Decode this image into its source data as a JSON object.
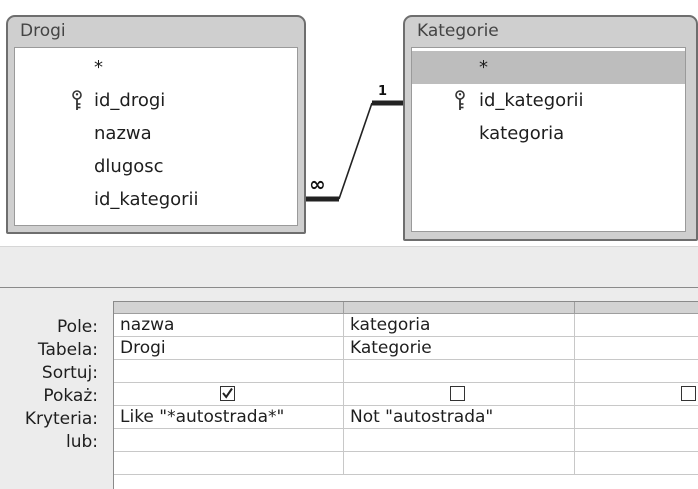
{
  "diagram": {
    "tables": [
      {
        "title": "Drogi",
        "fields": [
          {
            "name": "*",
            "is_key": false
          },
          {
            "name": "id_drogi",
            "is_key": true
          },
          {
            "name": "nazwa",
            "is_key": false
          },
          {
            "name": "dlugosc",
            "is_key": false
          },
          {
            "name": "id_kategorii",
            "is_key": false
          }
        ]
      },
      {
        "title": "Kategorie",
        "fields": [
          {
            "name": "*",
            "is_key": false,
            "selected": true
          },
          {
            "name": "id_kategorii",
            "is_key": true
          },
          {
            "name": "kategoria",
            "is_key": false
          }
        ]
      }
    ],
    "relationship": {
      "one_label": "1",
      "many_label": "∞"
    }
  },
  "grid": {
    "row_labels": {
      "pole": "Pole:",
      "tabela": "Tabela:",
      "sortuj": "Sortuj:",
      "pokaz": "Pokaż:",
      "kryteria": "Kryteria:",
      "lub": "lub:"
    },
    "columns": [
      {
        "pole": "nazwa",
        "tabela": "Drogi",
        "sortuj": "",
        "pokaz": true,
        "kryteria": "Like \"*autostrada*\"",
        "lub": ""
      },
      {
        "pole": "kategoria",
        "tabela": "Kategorie",
        "sortuj": "",
        "pokaz": false,
        "kryteria": "Not \"autostrada\"",
        "lub": ""
      },
      {
        "pole": "",
        "tabela": "",
        "sortuj": "",
        "pokaz": false,
        "kryteria": "",
        "lub": ""
      }
    ]
  }
}
